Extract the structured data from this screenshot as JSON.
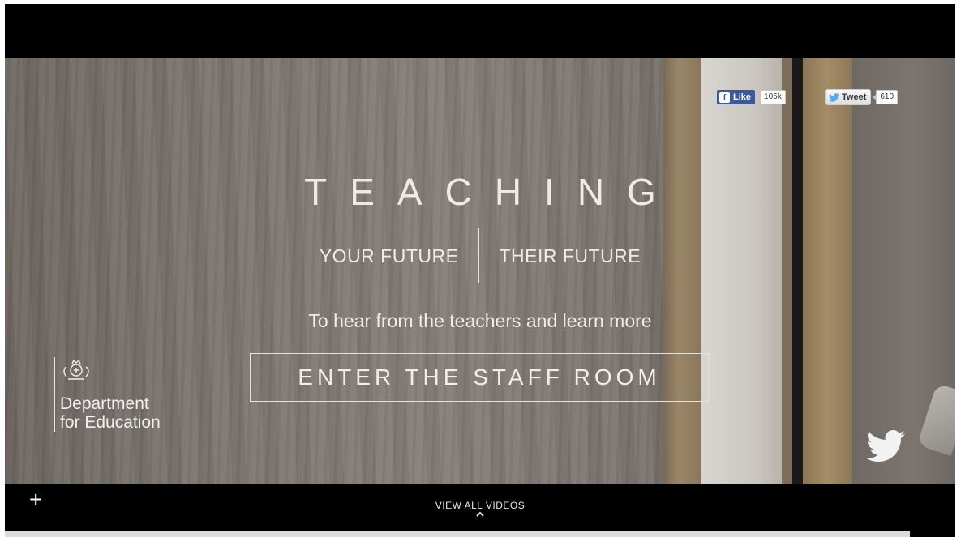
{
  "social": {
    "facebook": {
      "label": "Like",
      "count": "105k",
      "icon": "facebook-icon",
      "color": "#3b5998"
    },
    "twitter": {
      "label": "Tweet",
      "count": "610",
      "icon": "twitter-bird-icon",
      "color": "#55acee"
    }
  },
  "hero": {
    "title": "TEACHING",
    "tagline_left": "YOUR FUTURE",
    "tagline_right": "THEIR FUTURE",
    "subtitle": "To hear from the teachers and learn more",
    "cta_label": "ENTER THE STAFF ROOM"
  },
  "logo": {
    "line1": "Department",
    "line2": "for Education",
    "icon": "royal-crest-icon"
  },
  "footer": {
    "expand_icon": "plus-icon",
    "plus_symbol": "+",
    "view_all_label": "VIEW ALL VIDEOS",
    "chevron_icon": "chevron-up-icon"
  }
}
